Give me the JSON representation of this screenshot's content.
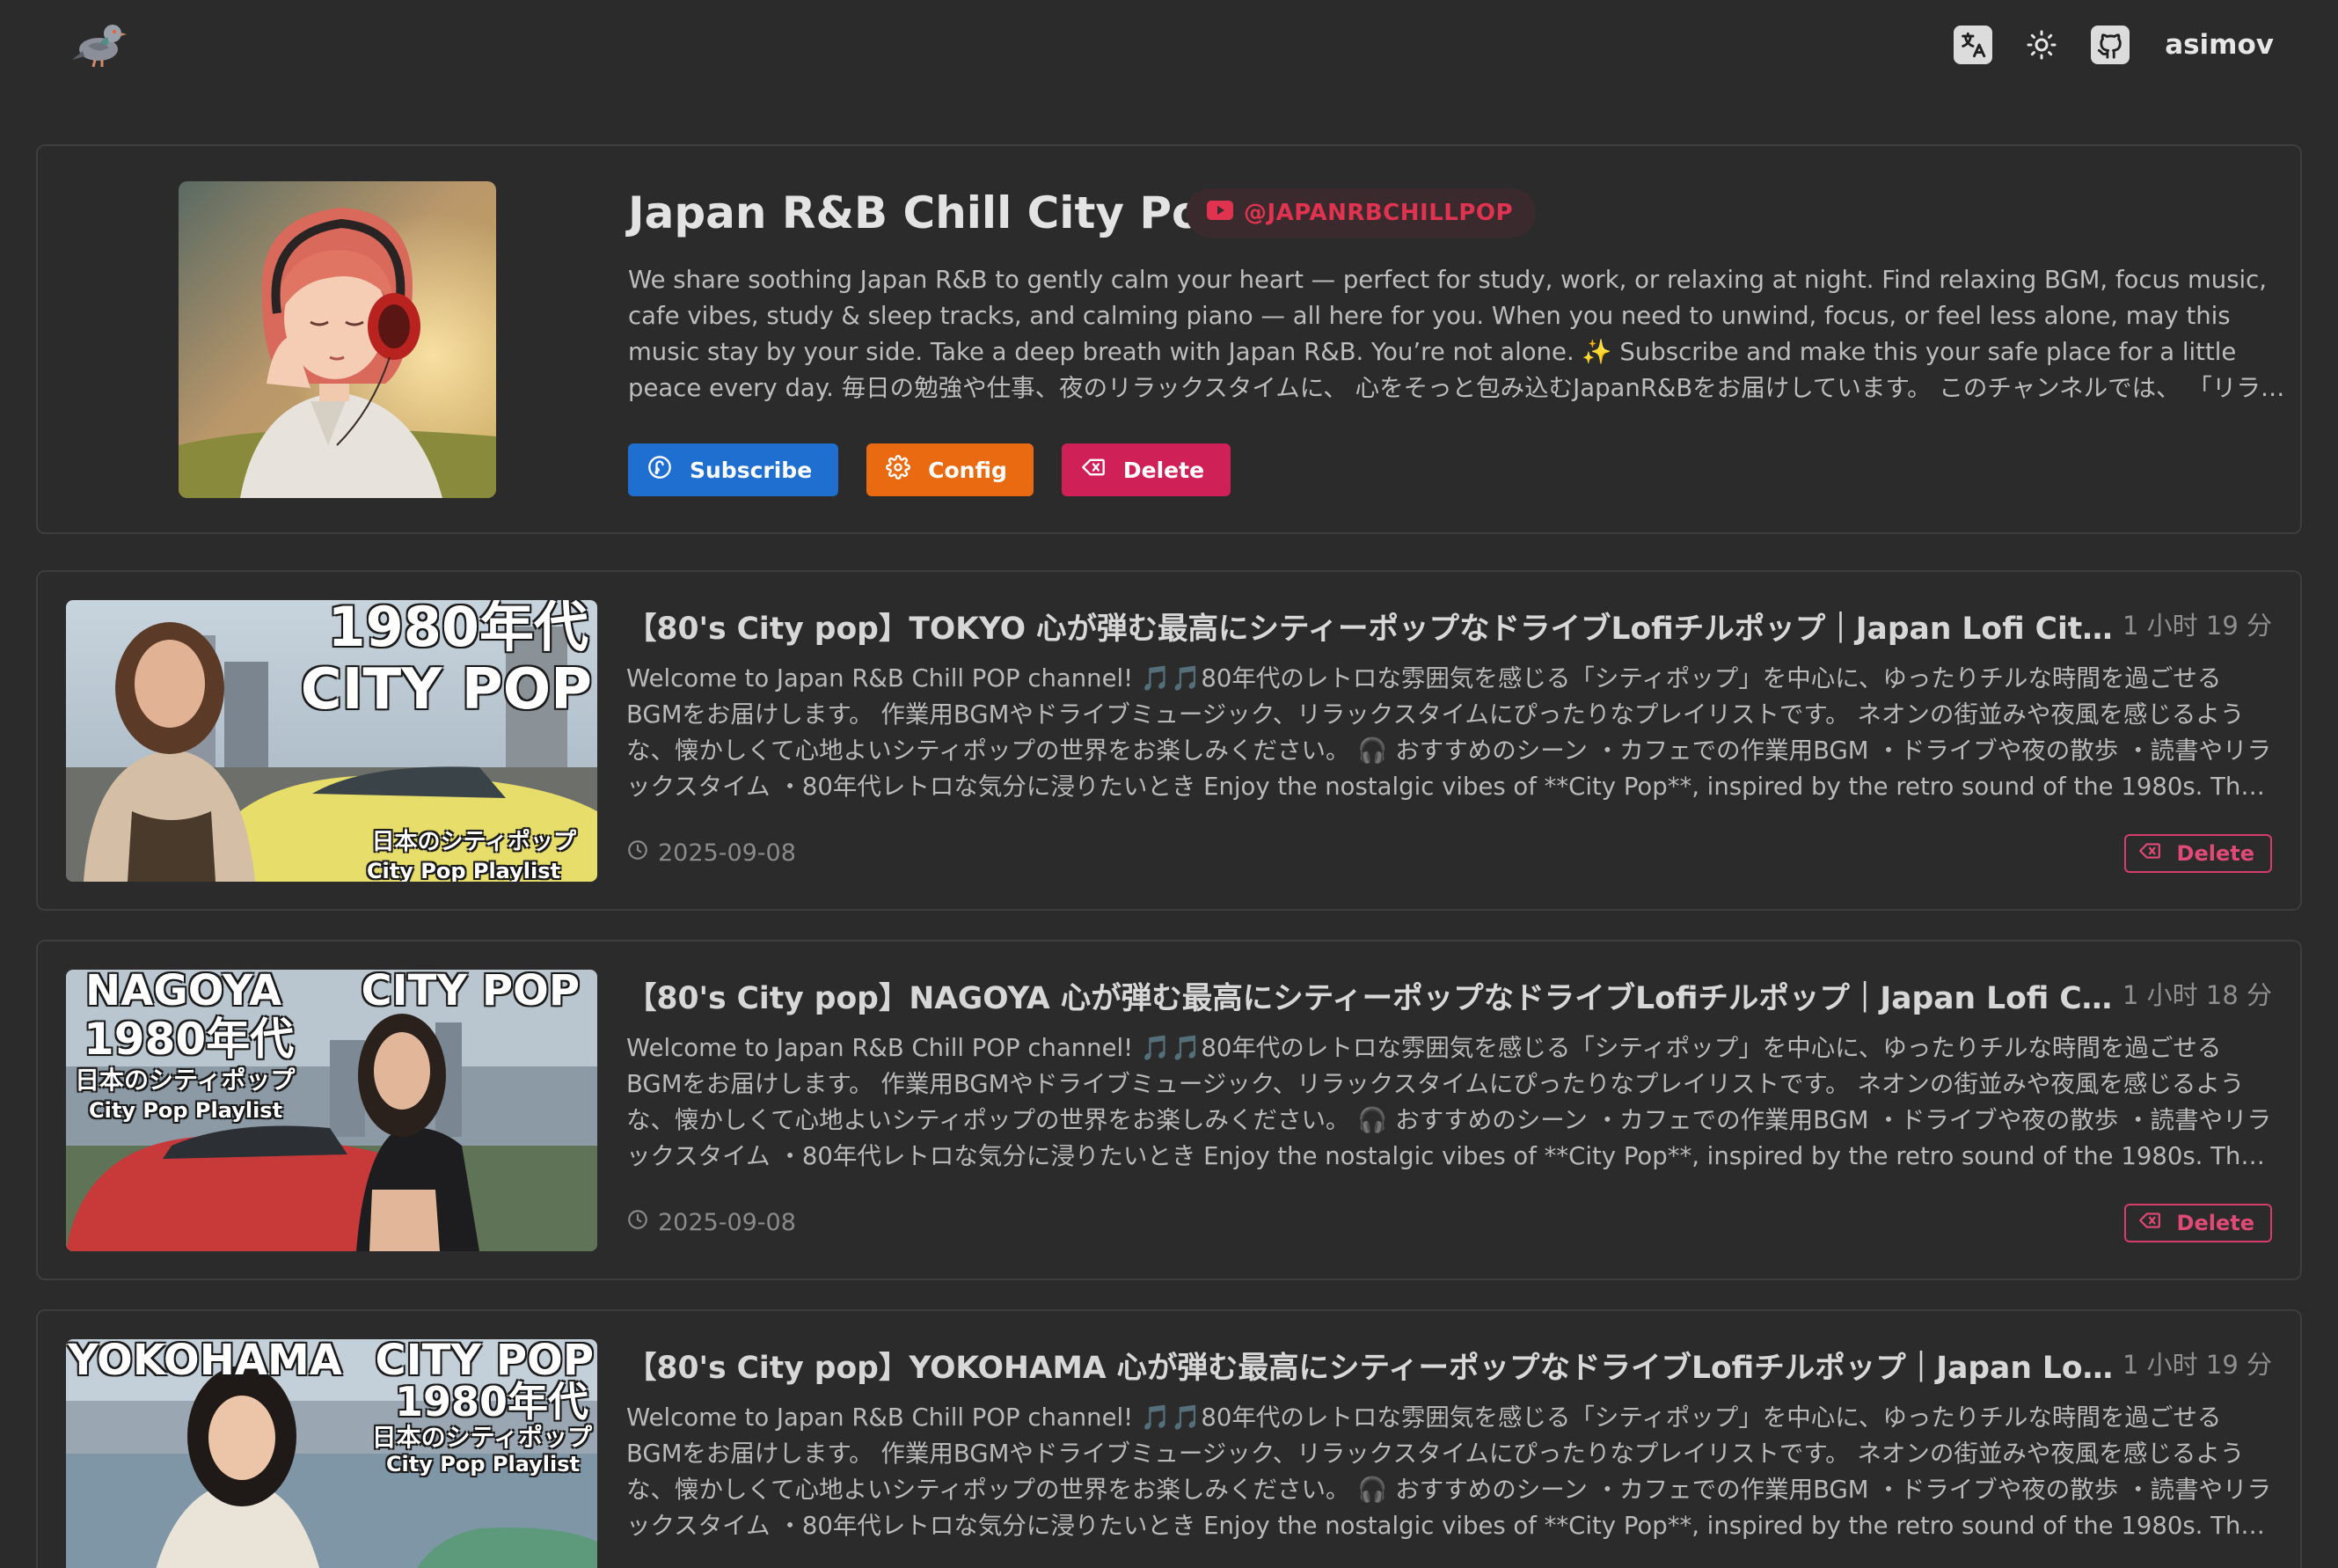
{
  "header": {
    "logo_icon": "pigeon-logo-icon",
    "actions": [
      {
        "name": "translate-icon"
      },
      {
        "name": "theme-toggle-icon"
      },
      {
        "name": "github-icon"
      }
    ],
    "username": "asimov"
  },
  "channel": {
    "title": "Japan R&B Chill City Pop",
    "handle": "@JAPANRBCHILLPOP",
    "handle_icon": "youtube-icon",
    "description": "We share soothing Japan R&B to gently calm your heart — perfect for study, work, or relaxing at night. Find relaxing BGM, focus music, cafe vibes, study & sleep tracks, and calming piano — all here for you. When you need to unwind, focus, or feel less alone, may this music stay by your side. Take a deep breath with Japan R&B. You’re not alone. ✨ Subscribe and make this your safe place for a little peace every day. 毎日の勉強や仕事、夜のリラックスタイムに、 心をそっと包み込むJapanR&Bをお届けしています。 このチャンネルでは、 「リラックスBGM」「集中できる作業用BGM」「カフェBGM」など",
    "buttons": {
      "subscribe": "Subscribe",
      "config": "Config",
      "delete": "Delete"
    },
    "colors": {
      "subscribe": "#1f6fd1",
      "config": "#ea6a12",
      "delete": "#cf2157",
      "handle": "#e0334f"
    }
  },
  "videos": [
    {
      "title": "【80's City pop】TOKYO 心が弾む最高にシティーポップなドライブLofiチルポップ｜Japan Lofi City Pop",
      "duration": "1 小时 19 分",
      "description": "Welcome to Japan R&B Chill POP channel! 🎵🎵80年代のレトロな雰囲気を感じる「シティポップ」を中心に、ゆったりチルな時間を過ごせるBGMをお届けします。 作業用BGMやドライブミュージック、リラックスタイムにぴったりなプレイリストです。 ネオンの街並みや夜風を感じるような、懐かしくて心地よいシティポップの世界をお楽しみください。 🎧 おすすめのシーン ・カフェでの作業用BGM ・ドライブや夜の散歩 ・読書やリラックスタイム ・80年代レトロな気分に浸りたいとき Enjoy the nostalgic vibes of **City Pop**, inspired by the retro sound of the 1980s. This playlist is perfect for",
      "date": "2025-09-08",
      "delete_label": "Delete",
      "thumb_text": [
        "1980年代",
        "CITY POP",
        "日本のシティポップ",
        "City Pop Playlist"
      ]
    },
    {
      "title": "【80's City pop】NAGOYA 心が弾む最高にシティーポップなドライブLofiチルポップ｜Japan Lofi City Pop",
      "duration": "1 小时 18 分",
      "description": "Welcome to Japan R&B Chill POP channel! 🎵🎵80年代のレトロな雰囲気を感じる「シティポップ」を中心に、ゆったりチルな時間を過ごせるBGMをお届けします。 作業用BGMやドライブミュージック、リラックスタイムにぴったりなプレイリストです。 ネオンの街並みや夜風を感じるような、懐かしくて心地よいシティポップの世界をお楽しみください。 🎧 おすすめのシーン ・カフェでの作業用BGM ・ドライブや夜の散歩 ・読書やリラックスタイム ・80年代レトロな気分に浸りたいとき Enjoy the nostalgic vibes of **City Pop**, inspired by the retro sound of the 1980s. This playlist is perfect for",
      "date": "2025-09-08",
      "delete_label": "Delete",
      "thumb_text": [
        "NAGOYA",
        "1980年代",
        "日本のシティポップ",
        "City Pop Playlist",
        "CITY POP"
      ]
    },
    {
      "title": "【80's City pop】YOKOHAMA 心が弾む最高にシティーポップなドライブLofiチルポップ｜Japan Lofi City Pop",
      "duration": "1 小时 19 分",
      "description": "Welcome to Japan R&B Chill POP channel! 🎵🎵80年代のレトロな雰囲気を感じる「シティポップ」を中心に、ゆったりチルな時間を過ごせるBGMをお届けします。 作業用BGMやドライブミュージック、リラックスタイムにぴったりなプレイリストです。 ネオンの街並みや夜風を感じるような、懐かしくて心地よいシティポップの世界をお楽しみください。 🎧 おすすめのシーン ・カフェでの作業用BGM ・ドライブや夜の散歩 ・読書やリラックスタイム ・80年代レトロな気分に浸りたいとき Enjoy the nostalgic vibes of **City Pop**, inspired by the retro sound of the 1980s. This playlist is perfect for",
      "date": "",
      "delete_label": "",
      "thumb_text": [
        "YOKOHAMA",
        "CITY POP",
        "1980年代",
        "日本のシティポップ",
        "City Pop Playlist"
      ]
    }
  ]
}
